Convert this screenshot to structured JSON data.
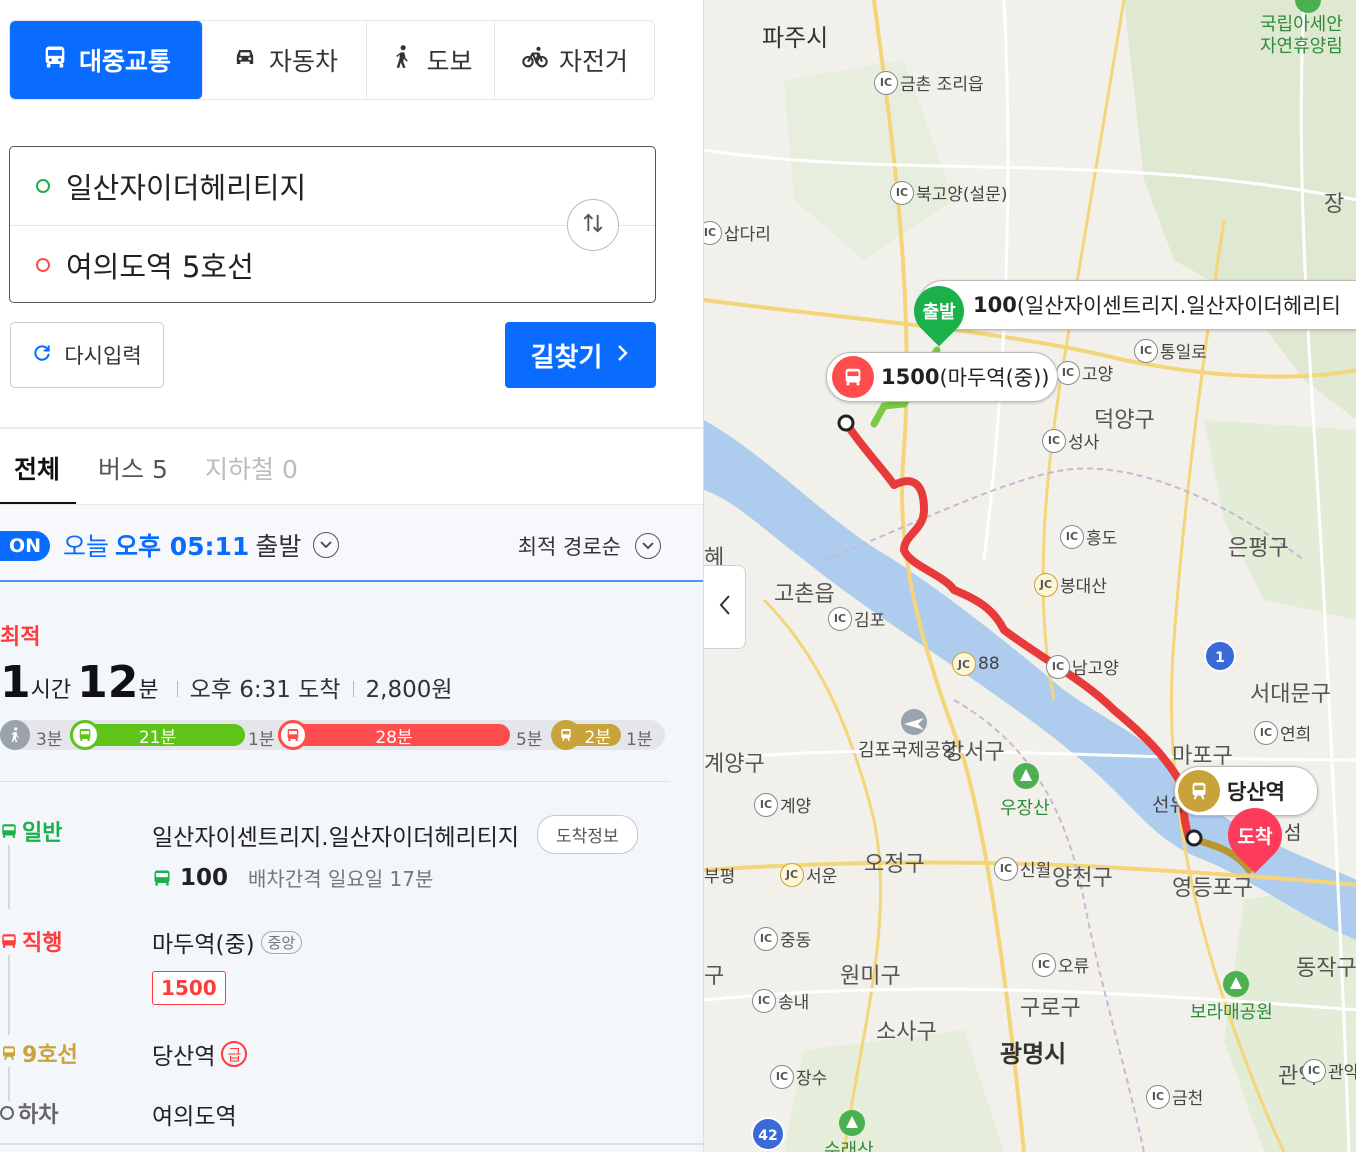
{
  "modes": [
    {
      "label": "대중교통",
      "icon": "bus-icon",
      "active": true
    },
    {
      "label": "자동차",
      "icon": "car-icon",
      "active": false
    },
    {
      "label": "도보",
      "icon": "walk-icon",
      "active": false
    },
    {
      "label": "자전거",
      "icon": "bicycle-icon",
      "active": false
    }
  ],
  "inputs": {
    "origin": "일산자이더헤리티지",
    "destination": "여의도역 5호선"
  },
  "actions": {
    "reset_label": "다시입력",
    "search_label": "길찾기"
  },
  "tabs": [
    {
      "label": "전체",
      "active": true
    },
    {
      "label": "버스 5",
      "active": false
    },
    {
      "label": "지하철 0",
      "active": false
    }
  ],
  "filter": {
    "on_badge": "ON",
    "depart_prefix": "오늘",
    "depart_time": "오후 05:11",
    "depart_suffix": "출발",
    "sort_label": "최적 경로순"
  },
  "result": {
    "badge": "최적",
    "hours": "1",
    "hours_unit": "시간",
    "minutes": "12",
    "minutes_unit": "분",
    "arrival": "오후 6:31 도착",
    "fare": "2,800원",
    "segments": {
      "walk1": "3분",
      "bus1": "21분",
      "transfer1": "1분",
      "bus2": "28분",
      "walk2": "5분",
      "subway": "2분",
      "walk3": "1분"
    },
    "steps": [
      {
        "kind": "일반",
        "name": "일산자이센트리지.일산자이더헤리티지",
        "pill": "도착정보",
        "bus_no": "100",
        "interval": "배차간격 일요일 17분",
        "color": "#1ab14b"
      },
      {
        "kind": "직행",
        "name": "마두역(중)",
        "tag": "중앙",
        "route": "1500",
        "color": "#ff3b3b"
      },
      {
        "kind": "9호선",
        "name": "당산역",
        "express": "급",
        "color": "#c8a23a"
      },
      {
        "kind": "하차",
        "name": "여의도역",
        "color": "#666"
      }
    ]
  },
  "map": {
    "callout_start": {
      "pin": "출발",
      "route": "100",
      "text": "(일산자이센트리지.일산자이더헤리티"
    },
    "callout_bus": {
      "route": "1500",
      "text": "(마두역(중))"
    },
    "callout_subway": {
      "text": "당산역"
    },
    "pin_end": "도착",
    "places": {
      "paju": "파주시",
      "deokyang": "덕양구",
      "eunpyeong": "은평구",
      "gochon": "고촌읍",
      "seodaemun": "서대문구",
      "mapo": "마포구",
      "gangseo": "강서구",
      "ojeong": "오정구",
      "yangcheon": "양천구",
      "yeongdeungpo": "영등포구",
      "wonmi": "원미구",
      "guro": "구로구",
      "sosa": "소사구",
      "gwangmyeong": "광명시",
      "dongjak": "동작구",
      "gwanak": "관악",
      "gyeyang": "계양구",
      "bupyeong": "부평",
      "jang": "장",
      "park1": "국립아세안\n자연휴양림",
      "park_usan": "우장산",
      "park_boramae": "보라매공원",
      "airport": "김포국제공항",
      "sura": "수래산",
      "seonyu": "선유",
      "yeouido_seom": "섬",
      "gu_frag": "구",
      "hye": "혜"
    },
    "ics": [
      {
        "type": "IC",
        "label": "금촌 조리읍"
      },
      {
        "type": "IC",
        "label": "북고양(설문)"
      },
      {
        "type": "IC",
        "label": "삽다리"
      },
      {
        "type": "IC",
        "label": "통일로"
      },
      {
        "type": "IC",
        "label": "고양"
      },
      {
        "type": "IC",
        "label": "성사"
      },
      {
        "type": "IC",
        "label": "흥도"
      },
      {
        "type": "JC",
        "label": "봉대산"
      },
      {
        "type": "IC",
        "label": "김포"
      },
      {
        "type": "JC",
        "label": "88"
      },
      {
        "type": "IC",
        "label": "남고양"
      },
      {
        "type": "IC",
        "label": "연희"
      },
      {
        "type": "IC",
        "label": "계양"
      },
      {
        "type": "JC",
        "label": "서운"
      },
      {
        "type": "IC",
        "label": "신월"
      },
      {
        "type": "IC",
        "label": "중동"
      },
      {
        "type": "IC",
        "label": "오류"
      },
      {
        "type": "IC",
        "label": "송내"
      },
      {
        "type": "IC",
        "label": "장수"
      },
      {
        "type": "IC",
        "label": "금천"
      },
      {
        "type": "IC",
        "label": "관악"
      }
    ],
    "route_badges": {
      "r1": "1",
      "r42": "42"
    }
  }
}
